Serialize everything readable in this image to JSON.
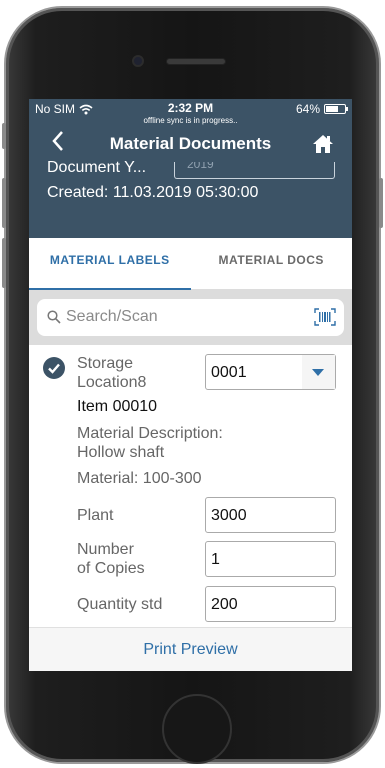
{
  "status_bar": {
    "carrier": "No SIM",
    "time": "2:32 PM",
    "sync_message": "offline sync is in progress..",
    "battery": "64%",
    "battery_level": 0.64
  },
  "nav": {
    "title": "Material Documents"
  },
  "header": {
    "document_year_label": "Document Y...",
    "document_year_value": "2019",
    "created": "Created: 11.03.2019 05:30:00"
  },
  "tabs": [
    {
      "label": "MATERIAL LABELS",
      "active": true
    },
    {
      "label": "MATERIAL DOCS",
      "active": false
    }
  ],
  "search": {
    "placeholder": "Search/Scan"
  },
  "item": {
    "storage_location_label_line1": "Storage",
    "storage_location_label_line2": "Location8",
    "storage_location_value": "0001",
    "item_number": "Item 00010",
    "material_description_label": "Material Description:",
    "material_description_value": "Hollow shaft",
    "material": "Material: 100-300",
    "plant_label": "Plant",
    "plant_value": "3000",
    "copies_label_line1": "Number",
    "copies_label_line2": "of Copies",
    "copies_value": "1",
    "quantity_label": "Quantity std",
    "quantity_value": "200"
  },
  "footer": {
    "print_preview_label": "Print Preview"
  },
  "colors": {
    "header_bg": "#3c5366",
    "accent": "#2f6fa7"
  },
  "icons": {
    "back": "chevron-left-icon",
    "home": "home-icon",
    "search": "search-icon",
    "barcode": "barcode-icon",
    "check": "check-circle-icon",
    "wifi": "wifi-icon",
    "battery": "battery-icon",
    "dropdown": "chevron-down-icon"
  }
}
